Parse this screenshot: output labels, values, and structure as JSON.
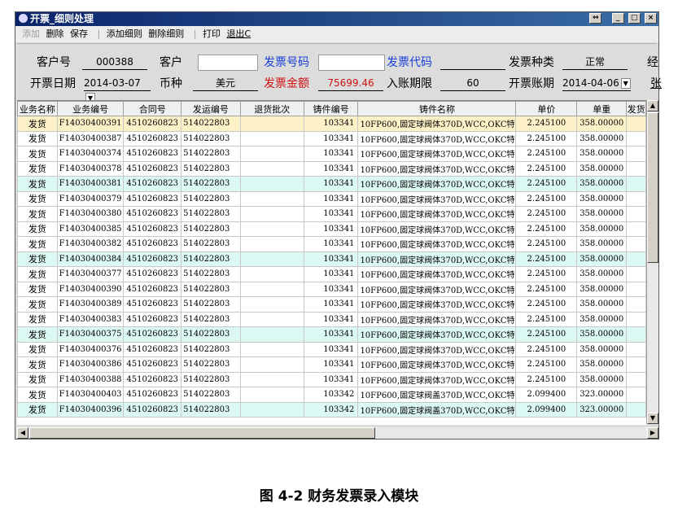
{
  "window": {
    "title": "开票_细则处理",
    "controls": {
      "restore": "↔",
      "minimize": "_",
      "maximize": "□",
      "close": "×"
    }
  },
  "toolbar": {
    "add": "添加",
    "delete": "删除",
    "save": "保存",
    "add_detail": "添加细则",
    "delete_detail": "删除细则",
    "print": "打印",
    "exit": "退出C"
  },
  "form": {
    "customer_no_label": "客户号",
    "customer_no": "000388",
    "customer_label": "客户",
    "customer": "",
    "invoice_no_label": "发票号码",
    "invoice_no": "",
    "invoice_code_label": "发票代码",
    "invoice_code": "",
    "invoice_type_label": "发票种类",
    "invoice_type": "正常",
    "cut_label_1": "经",
    "date_label": "开票日期",
    "date": "2014-03-07",
    "currency_label": "币种",
    "currency": "美元",
    "amount_label": "发票金额",
    "amount": "75699.46",
    "term_label": "入账期限",
    "term": "60",
    "account_date_label": "开票账期",
    "account_date": "2014-04-06",
    "cut_label_2": "张"
  },
  "table": {
    "headers": [
      "业务名称",
      "业务编号",
      "合同号",
      "发运编号",
      "退货批次",
      "铸件编号",
      "铸件名称",
      "单价",
      "单重",
      "发货"
    ],
    "rows": [
      [
        "发货",
        "F14030400391",
        "4510260823",
        "514022803",
        "",
        "103341",
        "10FP600,固定球阀体370D,WCC,OKC特",
        "2.245100",
        "358.00000"
      ],
      [
        "发货",
        "F14030400387",
        "4510260823",
        "514022803",
        "",
        "103341",
        "10FP600,固定球阀体370D,WCC,OKC特",
        "2.245100",
        "358.00000"
      ],
      [
        "发货",
        "F14030400374",
        "4510260823",
        "514022803",
        "",
        "103341",
        "10FP600,固定球阀体370D,WCC,OKC特",
        "2.245100",
        "358.00000"
      ],
      [
        "发货",
        "F14030400378",
        "4510260823",
        "514022803",
        "",
        "103341",
        "10FP600,固定球阀体370D,WCC,OKC特",
        "2.245100",
        "358.00000"
      ],
      [
        "发货",
        "F14030400381",
        "4510260823",
        "514022803",
        "",
        "103341",
        "10FP600,固定球阀体370D,WCC,OKC特",
        "2.245100",
        "358.00000"
      ],
      [
        "发货",
        "F14030400379",
        "4510260823",
        "514022803",
        "",
        "103341",
        "10FP600,固定球阀体370D,WCC,OKC特",
        "2.245100",
        "358.00000"
      ],
      [
        "发货",
        "F14030400380",
        "4510260823",
        "514022803",
        "",
        "103341",
        "10FP600,固定球阀体370D,WCC,OKC特",
        "2.245100",
        "358.00000"
      ],
      [
        "发货",
        "F14030400385",
        "4510260823",
        "514022803",
        "",
        "103341",
        "10FP600,固定球阀体370D,WCC,OKC特",
        "2.245100",
        "358.00000"
      ],
      [
        "发货",
        "F14030400382",
        "4510260823",
        "514022803",
        "",
        "103341",
        "10FP600,固定球阀体370D,WCC,OKC特",
        "2.245100",
        "358.00000"
      ],
      [
        "发货",
        "F14030400384",
        "4510260823",
        "514022803",
        "",
        "103341",
        "10FP600,固定球阀体370D,WCC,OKC特",
        "2.245100",
        "358.00000"
      ],
      [
        "发货",
        "F14030400377",
        "4510260823",
        "514022803",
        "",
        "103341",
        "10FP600,固定球阀体370D,WCC,OKC特",
        "2.245100",
        "358.00000"
      ],
      [
        "发货",
        "F14030400390",
        "4510260823",
        "514022803",
        "",
        "103341",
        "10FP600,固定球阀体370D,WCC,OKC特",
        "2.245100",
        "358.00000"
      ],
      [
        "发货",
        "F14030400389",
        "4510260823",
        "514022803",
        "",
        "103341",
        "10FP600,固定球阀体370D,WCC,OKC特",
        "2.245100",
        "358.00000"
      ],
      [
        "发货",
        "F14030400383",
        "4510260823",
        "514022803",
        "",
        "103341",
        "10FP600,固定球阀体370D,WCC,OKC特",
        "2.245100",
        "358.00000"
      ],
      [
        "发货",
        "F14030400375",
        "4510260823",
        "514022803",
        "",
        "103341",
        "10FP600,固定球阀体370D,WCC,OKC特",
        "2.245100",
        "358.00000"
      ],
      [
        "发货",
        "F14030400376",
        "4510260823",
        "514022803",
        "",
        "103341",
        "10FP600,固定球阀体370D,WCC,OKC特",
        "2.245100",
        "358.00000"
      ],
      [
        "发货",
        "F14030400386",
        "4510260823",
        "514022803",
        "",
        "103341",
        "10FP600,固定球阀体370D,WCC,OKC特",
        "2.245100",
        "358.00000"
      ],
      [
        "发货",
        "F14030400388",
        "4510260823",
        "514022803",
        "",
        "103341",
        "10FP600,固定球阀体370D,WCC,OKC特",
        "2.245100",
        "358.00000"
      ],
      [
        "发货",
        "F14030400403",
        "4510260823",
        "514022803",
        "",
        "103342",
        "10FP600,固定球阀盖370D,WCC,OKC特",
        "2.099400",
        "323.00000"
      ],
      [
        "发货",
        "F14030400396",
        "4510260823",
        "514022803",
        "",
        "103342",
        "10FP600,固定球阀盖370D,WCC,OKC特",
        "2.099400",
        "323.00000"
      ]
    ]
  },
  "scroll": {
    "up": "▲",
    "down": "▼",
    "left": "◀",
    "right": "▶"
  },
  "caption": "图 4-2  财务发票录入模块"
}
